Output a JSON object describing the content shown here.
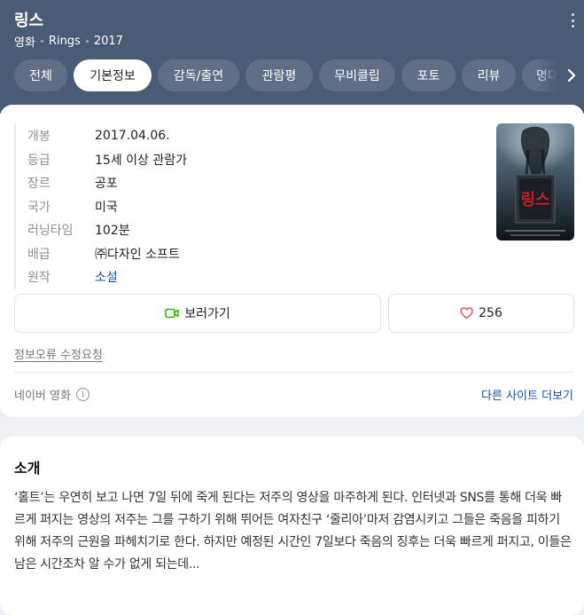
{
  "header": {
    "title": "링스",
    "meta": [
      "영화",
      "Rings",
      "2017"
    ]
  },
  "tabs": [
    "전체",
    "기본정보",
    "감독/출연",
    "관람평",
    "무비클립",
    "포토",
    "리뷰",
    "명대사"
  ],
  "active_tab": "기본정보",
  "info": [
    {
      "key": "개봉",
      "value": "2017.04.06."
    },
    {
      "key": "등급",
      "value": "15세 이상 관람가"
    },
    {
      "key": "장르",
      "value": "공포"
    },
    {
      "key": "국가",
      "value": "미국"
    },
    {
      "key": "러닝타임",
      "value": "102분"
    },
    {
      "key": "배급",
      "value": "㈜다자인 소프트"
    },
    {
      "key": "원작",
      "value": "소설"
    }
  ],
  "poster": {
    "title_text": "링스"
  },
  "actions": {
    "watch_label": "보러가기",
    "like_count": "256"
  },
  "error_report": "정보오류 수정요청",
  "source": {
    "label": "네이버 영화",
    "more_sites": "다른 사이트 더보기"
  },
  "synopsis": {
    "title": "소개",
    "text": "‘홀트’는 우연히 보고 나면 7일 뒤에 죽게 된다는 저주의 영상을 마주하게 된다. 인터넷과 SNS를 통해 더욱 빠르게 퍼지는 영상의 저주는 그를 구하기 위해 뛰어든 여자친구 ‘줄리아’마저 감염시키고 그들은 죽음을 피하기 위해 저주의 근원을 파헤치기로 한다. 하지만 예정된 시간인 7일보다 죽음의 징후는 더욱 빠르게 퍼지고, 이들은 남은 시간조차 알 수가 없게 되는데..."
  },
  "colors": {
    "header_bg": "#4a5b75",
    "tab_bg": "#5f6f88",
    "link": "#1a4fa0",
    "watch_icon": "#2db400",
    "heart_icon": "#e4505a"
  }
}
